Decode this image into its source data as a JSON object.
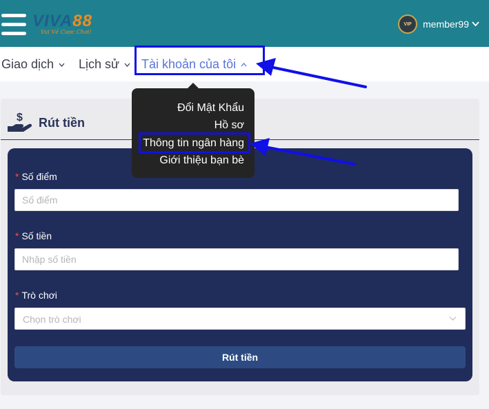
{
  "header": {
    "logo_text": "VIVA",
    "logo_number": "88",
    "logo_tagline": "Vui Vẻ Cược Chơi!",
    "vip_badge": "VIP",
    "username": "member99"
  },
  "nav": {
    "items": [
      {
        "label": "Giao dịch"
      },
      {
        "label": "Lịch sử"
      },
      {
        "label": "Tài khoản của tôi"
      }
    ]
  },
  "dropdown": {
    "items": [
      {
        "label": "Đổi Mật Khẩu"
      },
      {
        "label": "Hồ sơ"
      },
      {
        "label": "Thông tin ngân hàng"
      },
      {
        "label": "Giới thiệu bạn bè"
      }
    ]
  },
  "withdraw": {
    "title": "Rút tiền",
    "points_label": "Số điểm",
    "points_placeholder": "Số điểm",
    "amount_label": "Số tiền",
    "amount_placeholder": "Nhập số tiền",
    "game_label": "Trò chơi",
    "game_placeholder": "Chọn trò chơi",
    "submit_label": "Rút tiền"
  },
  "colors": {
    "header_bg": "#1f8090",
    "panel_bg": "#202c5a",
    "accent_nav": "#5a74d9",
    "annotation": "#1010e8"
  }
}
